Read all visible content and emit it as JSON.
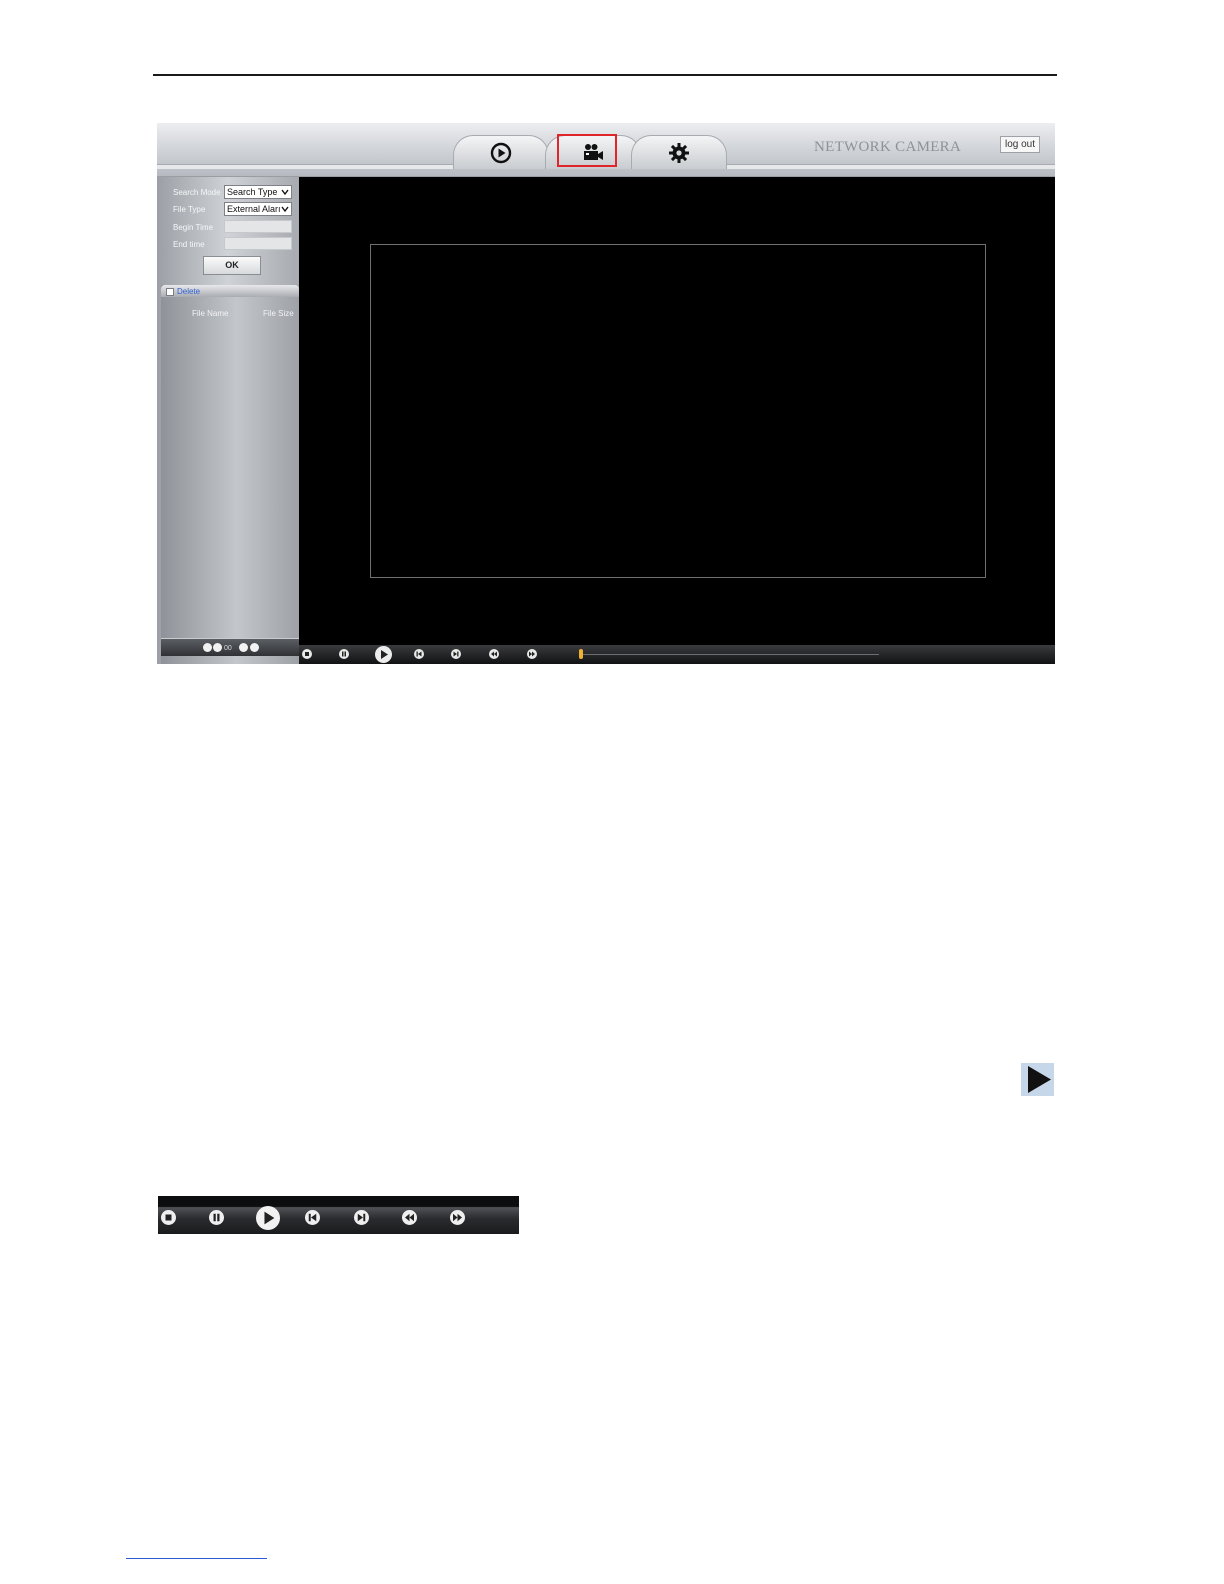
{
  "header": {
    "brand": "NETWORK CAMERA",
    "logout_label": "log out",
    "tabs": [
      {
        "name": "play-tab",
        "icon": "play-circle-icon"
      },
      {
        "name": "record-tab",
        "icon": "video-camera-icon",
        "selected": true
      },
      {
        "name": "settings-tab",
        "icon": "gear-icon"
      }
    ]
  },
  "search": {
    "search_mode_label": "Search Mode",
    "search_mode_value": "Search Type",
    "file_type_label": "File Type",
    "file_type_value": "External Aları",
    "begin_time_label": "Begin Time",
    "begin_time_value": "",
    "end_time_label": "End time",
    "end_time_value": "",
    "ok_label": "OK"
  },
  "file_list": {
    "delete_label": "Delete",
    "col_file_name": "File Name",
    "col_file_size": "File Size",
    "page_number": "00"
  },
  "player_controls": [
    "stop-icon",
    "pause-icon",
    "play-icon",
    "previous-icon",
    "next-icon",
    "rewind-icon",
    "fast-forward-icon"
  ],
  "colors": {
    "highlight": "#e0262b",
    "progress_knob": "#f0b331",
    "delete_link": "#2d5fd2"
  }
}
